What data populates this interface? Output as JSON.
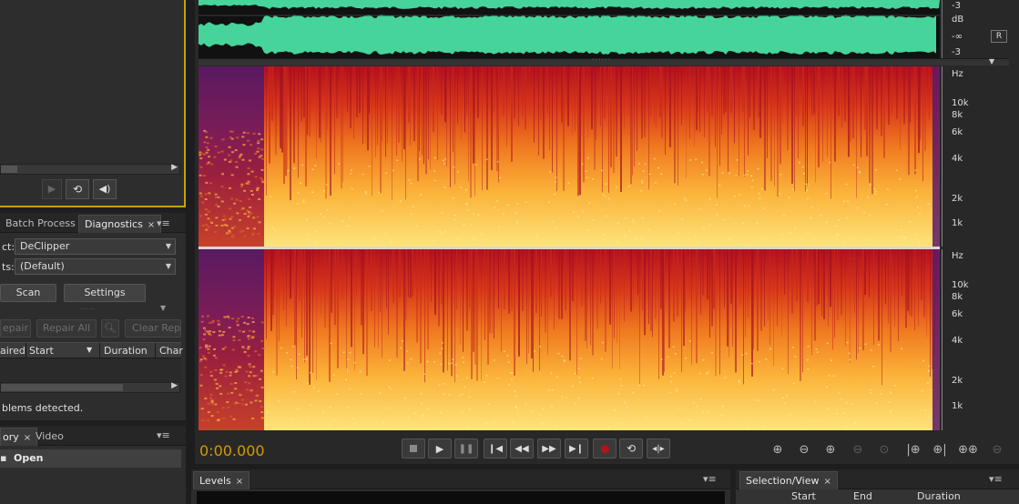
{
  "files_panel": {
    "play_icon": "play-icon",
    "loop_icon": "loop-icon",
    "volume_icon": "volume-icon"
  },
  "diagnostics_panel": {
    "tabs": [
      {
        "label": "Batch Process"
      },
      {
        "label": "Diagnostics",
        "close": "×"
      }
    ],
    "effect_label": "ct:",
    "effect_value": "DeClipper",
    "presets_label": "ts:",
    "presets_value": "(Default)",
    "scan_button": "Scan",
    "settings_button": "Settings",
    "repair_button": "epair",
    "repair_all_button": "Repair All",
    "clear_repaired_button": "Clear Repa",
    "columns": [
      "aired",
      "Start",
      "Duration",
      "Char"
    ],
    "status_text": "blems detected."
  },
  "history_panel": {
    "tabs": [
      {
        "label": "ory",
        "close": "×"
      },
      {
        "label": "Video"
      }
    ],
    "items": [
      {
        "label": "Open"
      }
    ]
  },
  "editor": {
    "db_labels_top": [
      "-3",
      "dB",
      "-∞",
      "-3"
    ],
    "channel_badge": "R",
    "hz_labels_ch1": [
      "Hz",
      "10k",
      "8k",
      "6k",
      "4k",
      "2k",
      "1k"
    ],
    "hz_labels_ch2": [
      "Hz",
      "10k",
      "8k",
      "6k",
      "4k",
      "2k",
      "1k"
    ],
    "time_display": "0:00.000",
    "time_color": "#d49a00",
    "waveform_color": "#46d49a",
    "transport": [
      "stop-icon",
      "play-icon",
      "pause-icon",
      "skip-start-icon",
      "rewind-icon",
      "fast-forward-icon",
      "skip-end-icon",
      "record-icon",
      "loop-icon",
      "skip-selection-icon"
    ],
    "zoom_tools": [
      "zoom-in-amplitude-icon",
      "zoom-out-amplitude-icon",
      "zoom-in-time-icon",
      "zoom-out-time-icon",
      "zoom-selection-icon",
      "zoom-in-left-icon",
      "zoom-in-right-icon",
      "zoom-full-icon",
      "zoom-out-full-icon"
    ]
  },
  "levels_panel": {
    "title": "Levels",
    "close": "×"
  },
  "selection_panel": {
    "title": "Selection/View",
    "close": "×",
    "columns": [
      "Start",
      "End",
      "Duration"
    ]
  }
}
